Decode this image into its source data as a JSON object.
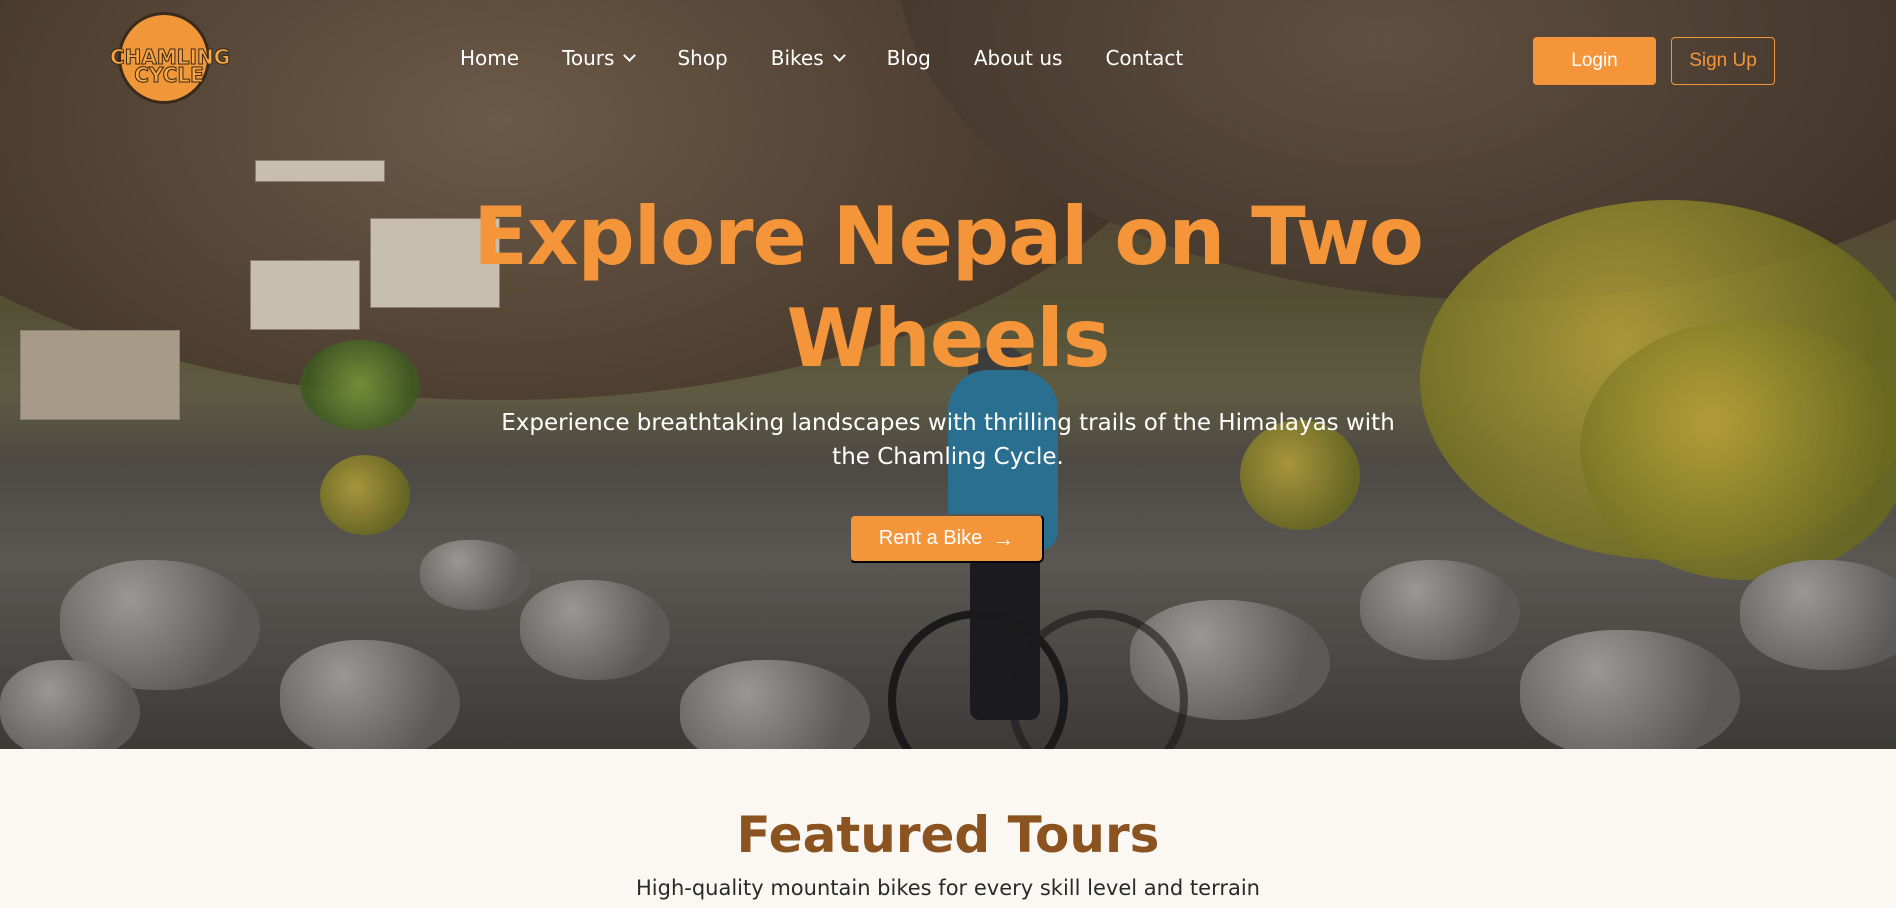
{
  "brand": {
    "line1": "CHAMLING",
    "line2": "CYCLE"
  },
  "nav": {
    "items": [
      {
        "label": "Home",
        "dropdown": false
      },
      {
        "label": "Tours",
        "dropdown": true
      },
      {
        "label": "Shop",
        "dropdown": false
      },
      {
        "label": "Bikes",
        "dropdown": true
      },
      {
        "label": "Blog",
        "dropdown": false
      },
      {
        "label": "About us",
        "dropdown": false
      },
      {
        "label": "Contact",
        "dropdown": false
      }
    ]
  },
  "auth": {
    "login_label": "Login",
    "signup_label": "Sign Up"
  },
  "hero": {
    "title_line1": "Explore Nepal on Two",
    "title_line2": "Wheels",
    "subtitle": "Experience breathtaking landscapes with thrilling trails of the Himalayas with the Chamling Cycle.",
    "cta_label": "Rent a Bike",
    "cta_icon": "arrow-right-icon"
  },
  "featured": {
    "title": "Featured Tours",
    "subtitle": "High-quality mountain bikes for every skill level and terrain"
  },
  "colors": {
    "accent": "#f5953a",
    "heading_brown": "#8a5320",
    "page_bg": "#fbf8f4"
  }
}
